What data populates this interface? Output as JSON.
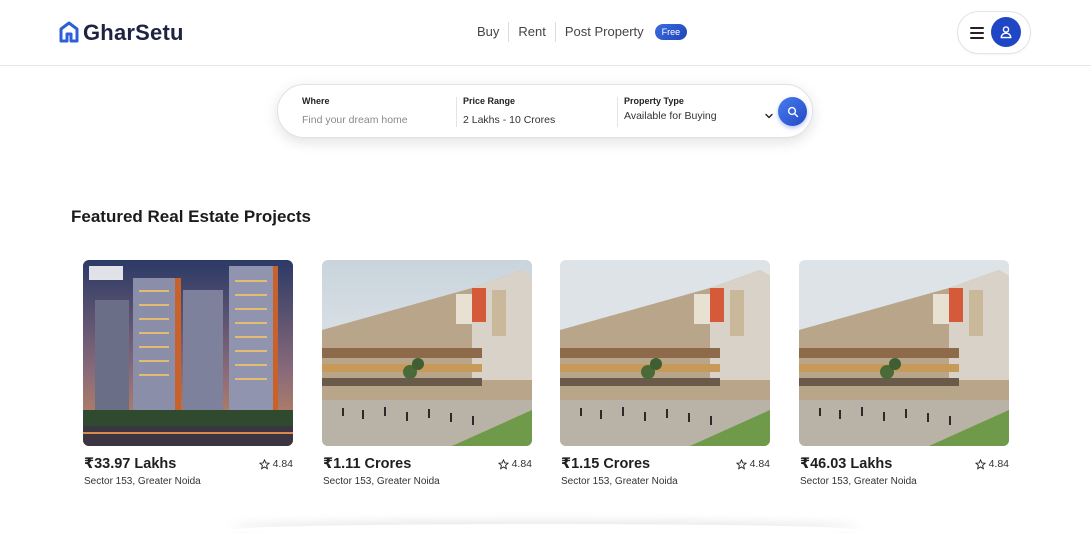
{
  "brand": {
    "name": "GharSetu"
  },
  "nav": {
    "items": [
      "Buy",
      "Rent",
      "Post Property"
    ],
    "badge": "Free"
  },
  "search": {
    "where_label": "Where",
    "where_placeholder": "Find your dream home",
    "price_label": "Price Range",
    "price_value": "2 Lakhs - 10 Crores",
    "type_label": "Property Type",
    "type_value": "Available for Buying"
  },
  "featured": {
    "title": "Featured Real Estate Projects",
    "cards": [
      {
        "price": "₹33.97 Lakhs",
        "rating": "4.84",
        "location": "Sector 153, Greater Noida",
        "image": "residential-towers-night"
      },
      {
        "price": "₹1.11 Crores",
        "rating": "4.84",
        "location": "Sector 153, Greater Noida",
        "image": "commercial-mall-day"
      },
      {
        "price": "₹1.15 Crores",
        "rating": "4.84",
        "location": "Sector 153, Greater Noida",
        "image": "commercial-mall-day"
      },
      {
        "price": "₹46.03 Lakhs",
        "rating": "4.84",
        "location": "Sector 153, Greater Noida",
        "image": "commercial-mall-day"
      }
    ]
  },
  "colors": {
    "accent": "#1f47c5",
    "logo": "#2f5fd8",
    "text": "#1d2340"
  }
}
